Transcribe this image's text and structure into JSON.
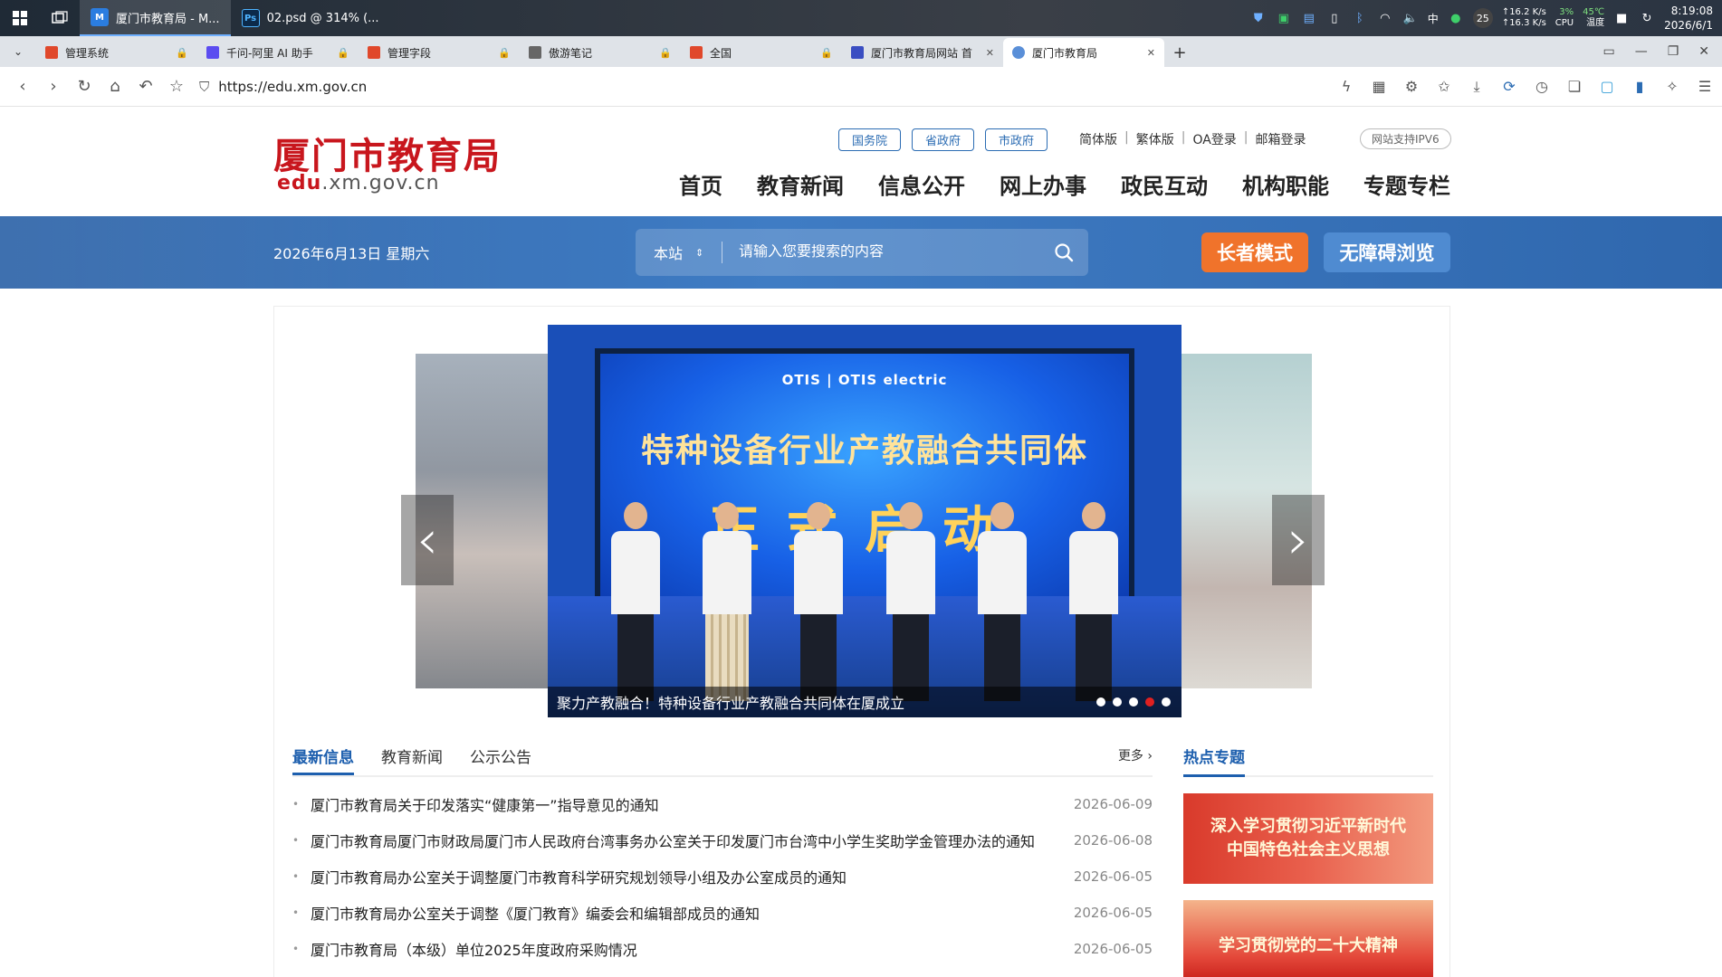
{
  "taskbar": {
    "tasks": [
      {
        "label": "厦门市教育局 - M..."
      },
      {
        "label": "02.psd @ 314% (..."
      }
    ],
    "tray": {
      "lang": "中",
      "badge": "25",
      "net_up": "↑16.2 K/s",
      "net_down": "↑16.3 K/s",
      "cpu": "3%",
      "cpu_label": "CPU",
      "temp": "45℃",
      "temp_label": "温度",
      "time": "8:19:08",
      "date": "2026/6/1"
    }
  },
  "browser": {
    "tabs": [
      {
        "label": "管理系统",
        "color": "#e0482b"
      },
      {
        "label": "千问-阿里 AI 助手",
        "color": "#5b4cf0"
      },
      {
        "label": "管理字段",
        "color": "#e0482b"
      },
      {
        "label": "傲游笔记",
        "color": "#666666"
      },
      {
        "label": "全国",
        "color": "#e0482b"
      },
      {
        "label": "厦门市教育局网站 首",
        "color": "#3a4ec2"
      },
      {
        "label": "厦门市教育局",
        "color": "#5a8fd8"
      }
    ],
    "url": "https://edu.xm.gov.cn"
  },
  "header": {
    "logo_cn": "厦门市教育局",
    "logo_en_red": "edu",
    "logo_en_rest": ".xm.gov.cn",
    "gov_links": [
      "国务院",
      "省政府",
      "市政府"
    ],
    "top_links": [
      "简体版",
      "繁体版",
      "OA登录",
      "邮箱登录"
    ],
    "ipv6": "网站支持IPV6",
    "nav": [
      "首页",
      "教育新闻",
      "信息公开",
      "网上办事",
      "政民互动",
      "机构职能",
      "专题专栏"
    ]
  },
  "band": {
    "date": "2026年6月13日 星期六",
    "scope": "本站",
    "search_placeholder": "请输入您要搜索的内容",
    "elder_mode": "长者模式",
    "accessible": "无障碍浏览"
  },
  "carousel": {
    "sponsors": "OTIS | OTIS electric",
    "slogan_line1": "特种设备行业产教融合共同体",
    "slogan_line2": "正式启动",
    "caption": "聚力产教融合！特种设备行业产教融合共同体在厦成立",
    "total_slides": 5,
    "active_slide": 4,
    "prev": "‹",
    "next": "›"
  },
  "news": {
    "tabs": [
      "最新信息",
      "教育新闻",
      "公示公告"
    ],
    "more": "更多 ›",
    "items": [
      {
        "title": "厦门市教育局关于印发落实“健康第一”指导意见的通知",
        "date": "2026-06-09"
      },
      {
        "title": "厦门市教育局厦门市财政局厦门市人民政府台湾事务办公室关于印发厦门市台湾中小学生奖助学金管理办法的通知",
        "date": "2026-06-08"
      },
      {
        "title": "厦门市教育局办公室关于调整厦门市教育科学研究规划领导小组及办公室成员的通知",
        "date": "2026-06-05"
      },
      {
        "title": "厦门市教育局办公室关于调整《厦门教育》编委会和编辑部成员的通知",
        "date": "2026-06-05"
      },
      {
        "title": "厦门市教育局（本级）单位2025年度政府采购情况",
        "date": "2026-06-05"
      }
    ]
  },
  "hot": {
    "title": "热点专题",
    "banner1_line1": "深入学习贯彻习近平新时代",
    "banner1_line2": "中国特色社会主义思想",
    "banner2": "学习贯彻党的二十大精神"
  }
}
